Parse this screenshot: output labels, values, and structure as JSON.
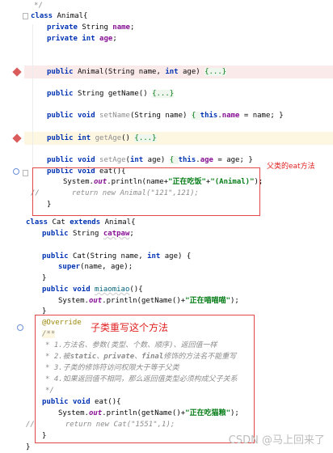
{
  "code": {
    "l01": "*/",
    "l02": [
      "class ",
      "Animal{"
    ],
    "l03": [
      "private ",
      "String ",
      "name",
      ";"
    ],
    "l04": [
      "private ",
      "int ",
      "age",
      ";"
    ],
    "l05": [
      "public ",
      "Animal(String name, ",
      "int ",
      "age) ",
      "{...}"
    ],
    "l06": [
      "public ",
      "String getName() ",
      "{...}"
    ],
    "l07": [
      "public ",
      "void ",
      "setName",
      "(String name) ",
      "{ ",
      "this",
      ".",
      "name",
      " = name; }"
    ],
    "l08": [
      "public ",
      "int ",
      "getAge",
      "() ",
      "{...}"
    ],
    "l09": [
      "public ",
      "void ",
      "setAge",
      "(",
      "int ",
      "age) ",
      "{ ",
      "this",
      ".",
      "age",
      " = age; }"
    ],
    "l10": [
      "public ",
      "void ",
      "eat(){"
    ],
    "l11": [
      "System.",
      "out",
      ".println(name+",
      "\"正在吃饭\"",
      "+",
      "\"(Animal)\"",
      ");"
    ],
    "l12": [
      "//",
      "return new Animal(\"121\",121);"
    ],
    "l13": "}",
    "l14": [
      "class ",
      "Cat ",
      "extends ",
      "Animal{"
    ],
    "l15": [
      "public ",
      "String ",
      "catpaw",
      ";"
    ],
    "l16": [
      "public ",
      "Cat(String name, ",
      "int ",
      "age) {"
    ],
    "l17": [
      "super",
      "(name, age);"
    ],
    "l18": "}",
    "l19": [
      "public ",
      "void ",
      "miaomiao",
      "(){"
    ],
    "l20": [
      "System.",
      "out",
      ".println(getName()+",
      "\"正在喵喵喵\"",
      ");"
    ],
    "l21": "}",
    "l22": "@Override",
    "l23": "/**",
    "l24": "* 1.方法名、参数(类型、个数、顺序)、返回值一样",
    "l25": [
      "* 2.被",
      "static",
      "、",
      "private",
      "、",
      "final",
      "修饰的方法名不能重写"
    ],
    "l26": "* 3.子类的修饰符访问权限大于等于父类",
    "l27": "* 4.如果返回值不相同，那么返回值类型必须构成父子关系",
    "l28": "*/",
    "l29": [
      "public ",
      "void ",
      "eat(){"
    ],
    "l30": [
      "System.",
      "out",
      ".println(getName()+",
      "\"正在吃猫粮\"",
      ");"
    ],
    "l31": [
      "//",
      "return new Cat(\"1551\",1);"
    ],
    "l32": "}",
    "l33": "}"
  },
  "annotations": {
    "parent_eat": "父类的eat方法",
    "override_note": "子类重写这个方法"
  },
  "watermark": "CSDN @马上回来了",
  "colors": {
    "keyword": "#0033b3",
    "field": "#871094",
    "string": "#067d17",
    "comment": "#8c8c8c",
    "annotation": "#9e880d",
    "note_red": "#e02020",
    "breakpoint": "#db5c5c"
  }
}
